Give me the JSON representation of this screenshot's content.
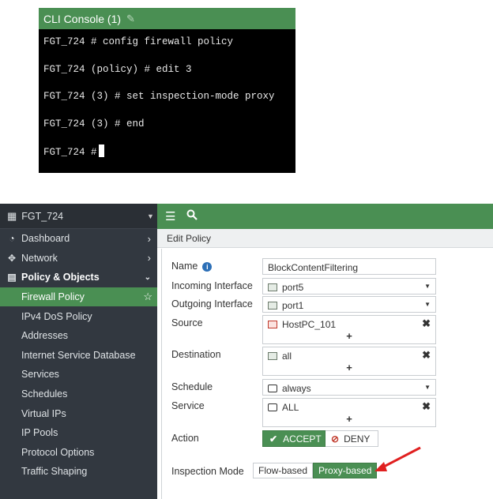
{
  "cli": {
    "title": "CLI Console (1)",
    "lines": [
      "FGT_724 # config firewall policy",
      "FGT_724 (policy) # edit 3",
      "FGT_724 (3) # set inspection-mode proxy",
      "FGT_724 (3) # end",
      "FGT_724 #"
    ]
  },
  "sidebar": {
    "device": "FGT_724",
    "items": [
      {
        "label": "Dashboard",
        "icon": "dashboard-icon"
      },
      {
        "label": "Network",
        "icon": "network-icon"
      },
      {
        "label": "Policy & Objects",
        "icon": "policy-icon"
      },
      {
        "label": "Firewall Policy"
      },
      {
        "label": "IPv4 DoS Policy"
      },
      {
        "label": "Addresses"
      },
      {
        "label": "Internet Service Database"
      },
      {
        "label": "Services"
      },
      {
        "label": "Schedules"
      },
      {
        "label": "Virtual IPs"
      },
      {
        "label": "IP Pools"
      },
      {
        "label": "Protocol Options"
      },
      {
        "label": "Traffic Shaping"
      }
    ]
  },
  "topbar": {
    "menu_icon": "hamburger-icon",
    "search_icon": "search-icon"
  },
  "breadcrumb": "Edit Policy",
  "form": {
    "name_label": "Name",
    "name_value": "BlockContentFiltering",
    "incoming_label": "Incoming Interface",
    "incoming_value": "port5",
    "outgoing_label": "Outgoing Interface",
    "outgoing_value": "port1",
    "source_label": "Source",
    "source_value": "HostPC_101",
    "destination_label": "Destination",
    "destination_value": "all",
    "schedule_label": "Schedule",
    "schedule_value": "always",
    "service_label": "Service",
    "service_value": "ALL",
    "action_label": "Action",
    "accept_label": "ACCEPT",
    "deny_label": "DENY",
    "inspection_label": "Inspection Mode",
    "flow_label": "Flow-based",
    "proxy_label": "Proxy-based"
  },
  "colors": {
    "accent": "#4a8f53",
    "sidebar": "#323840",
    "annotation_arrow": "#e02020"
  }
}
